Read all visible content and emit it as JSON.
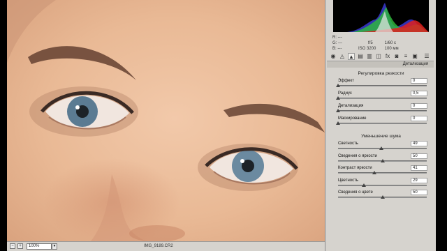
{
  "statusbar": {
    "zoom": "100%",
    "filename": "IMG_9189.CR2"
  },
  "readout": {
    "r_label": "R:",
    "r_value": "---",
    "g_label": "G:",
    "g_value": "---",
    "b_label": "B:",
    "b_value": "---",
    "aperture": "f/5",
    "shutter": "1/60 с",
    "iso": "ISO 3200",
    "focal": "100 мм"
  },
  "tabs": [
    "camera-calibration-icon",
    "tone-curve-icon",
    "detail-icon",
    "hsl-icon",
    "split-toning-icon",
    "lens-corrections-icon",
    "effects-icon",
    "camera-icon",
    "presets-icon",
    "snapshots-icon"
  ],
  "section_title": "Детализация",
  "sharpening": {
    "title": "Регулировка резкости",
    "sliders": [
      {
        "label": "Эффект",
        "value": "0",
        "fraction": 0.0
      },
      {
        "label": "Радиус",
        "value": "0,5",
        "fraction": 0.0
      },
      {
        "label": "Детализация",
        "value": "0",
        "fraction": 0.0
      },
      {
        "label": "Маскирование",
        "value": "0",
        "fraction": 0.0
      }
    ]
  },
  "noise": {
    "title": "Уменьшение шума",
    "sliders": [
      {
        "label": "Светность",
        "value": "49",
        "fraction": 0.49
      },
      {
        "label": "Сведения о яркости",
        "value": "50",
        "fraction": 0.5
      },
      {
        "label": "Контраст яркости",
        "value": "41",
        "fraction": 0.41
      },
      {
        "label": "Цветность",
        "value": "29",
        "fraction": 0.29
      },
      {
        "label": "Сведения о цвете",
        "value": "50",
        "fraction": 0.5
      }
    ]
  },
  "colors": {
    "panel_bg": "#d6d3ce",
    "histogram_bg": "#000000"
  }
}
